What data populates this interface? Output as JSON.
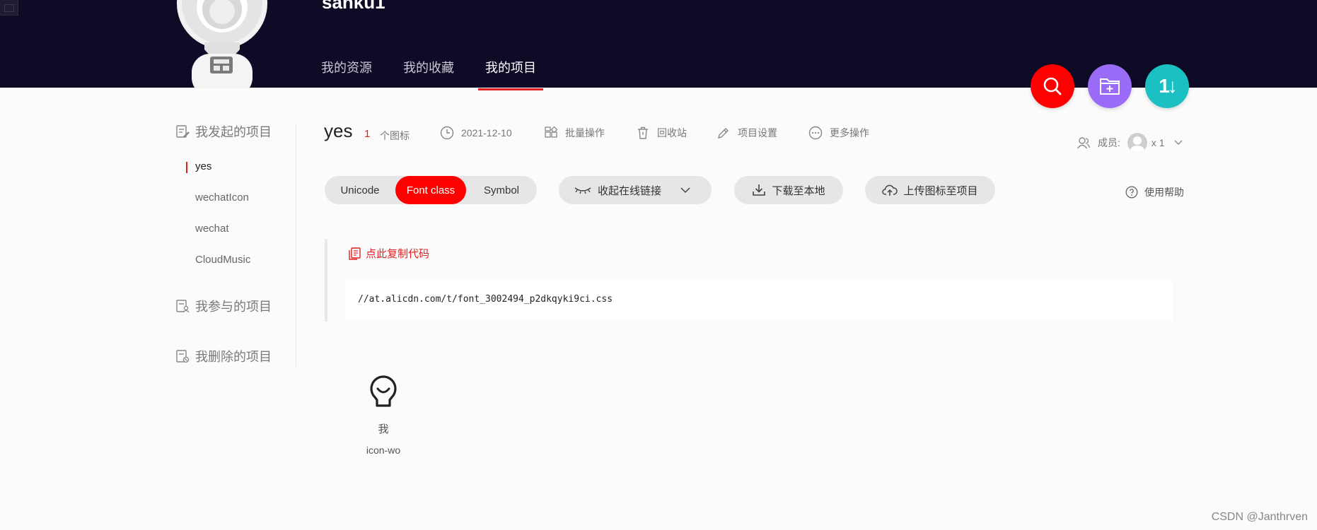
{
  "header": {
    "username": "sanku1",
    "nav": [
      {
        "label": "我的资源"
      },
      {
        "label": "我的收藏"
      },
      {
        "label": "我的项目"
      }
    ],
    "colors": {
      "background": "#0d0b25",
      "accent": "#e02020"
    },
    "fabs": [
      {
        "icon": "search-icon",
        "color": "#ff0000"
      },
      {
        "icon": "add-folder-icon",
        "color": "#9a6bf6"
      },
      {
        "icon": "sort-icon",
        "color": "#1bc1c2",
        "text": "1↓"
      }
    ]
  },
  "sidebar": {
    "group_created": "我发起的项目",
    "projects": [
      {
        "label": "yes"
      },
      {
        "label": "wechatIcon"
      },
      {
        "label": "wechat"
      },
      {
        "label": "CloudMusic"
      }
    ],
    "group_joined": "我参与的项目",
    "group_deleted": "我删除的项目"
  },
  "project": {
    "title": "yes",
    "icon_count": "1",
    "icon_count_label": "个图标",
    "date": "2021-12-10",
    "batch": "批量操作",
    "recycle": "回收站",
    "settings": "项目设置",
    "more": "更多操作",
    "members_label": "成员:",
    "members_count": "x 1"
  },
  "tabs": {
    "unicode": "Unicode",
    "font_class": "Font class",
    "symbol": "Symbol"
  },
  "actions": {
    "collapse_link": "收起在线链接",
    "download": "下载至本地",
    "upload": "上传图标至项目",
    "help": "使用帮助"
  },
  "code": {
    "copy_label": "点此复制代码",
    "url": "//at.alicdn.com/t/font_3002494_p2dkqyki9ci.css"
  },
  "icons": [
    {
      "name": "我",
      "code": "icon-wo",
      "glyph": "bulb-icon"
    }
  ],
  "watermark": "CSDN @Janthrven"
}
